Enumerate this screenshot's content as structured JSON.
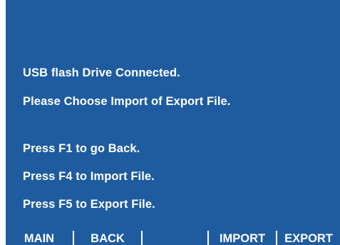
{
  "screen": {
    "lines": [
      "USB flash Drive Connected.",
      "Please Choose Import of Export File.",
      "Press F1 to go Back.",
      "Press F4 to Import File.",
      "Press F5 to Export File."
    ]
  },
  "softkeys": [
    {
      "key": "F1",
      "label": "MAIN"
    },
    {
      "key": "F2",
      "label": "BACK"
    },
    {
      "key": "F3",
      "label": ""
    },
    {
      "key": "F4",
      "label": "IMPORT"
    },
    {
      "key": "F5",
      "label": "EXPORT"
    }
  ],
  "colors": {
    "screen_background": "#1f5c9f",
    "text": "#ffffff",
    "separator": "#ffffff"
  }
}
